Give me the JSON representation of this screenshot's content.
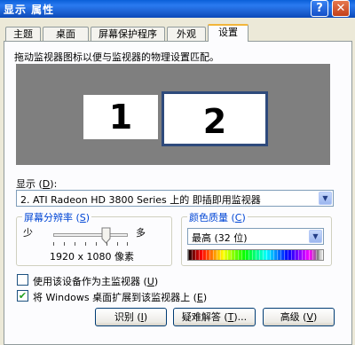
{
  "window": {
    "title": "显示 属性",
    "help_glyph": "?",
    "close_glyph": "✕"
  },
  "tabs": [
    {
      "label": "主题"
    },
    {
      "label": "桌面"
    },
    {
      "label": "屏幕保护程序"
    },
    {
      "label": "外观"
    },
    {
      "label": "设置",
      "active": true
    }
  ],
  "settings": {
    "instruction": "拖动监视器图标以便与监视器的物理设置匹配。",
    "monitors": [
      {
        "number": "1",
        "selected": false
      },
      {
        "number": "2",
        "selected": true
      }
    ],
    "display_label_prefix": "显示 (",
    "display_label_key": "D",
    "display_label_suffix": "):",
    "display_value": "2. ATI Radeon HD 3800 Series  上的 即插即用监视器",
    "resolution": {
      "title_prefix": "屏幕分辨率 (",
      "title_key": "S",
      "title_suffix": ")",
      "less": "少",
      "more": "多",
      "value": "1920 x 1080 像素",
      "slider_level": 0.65
    },
    "color_quality": {
      "title_prefix": "颜色质量 (",
      "title_key": "C",
      "title_suffix": ")",
      "value": "最高 (32 位)"
    },
    "checkbox_primary": {
      "label_prefix": "使用该设备作为主监视器 (",
      "label_key": "U",
      "label_suffix": ")",
      "checked": false
    },
    "checkbox_extend": {
      "label_prefix": "将 Windows 桌面扩展到该监视器上 (",
      "label_key": "E",
      "label_suffix": ")",
      "checked": true
    },
    "buttons": {
      "identify_prefix": "识别 (",
      "identify_key": "I",
      "identify_suffix": ")",
      "troubleshoot_prefix": "疑难解答 (",
      "troubleshoot_key": "T",
      "troubleshoot_suffix": ")...",
      "advanced_prefix": "高级 (",
      "advanced_key": "V",
      "advanced_suffix": ")"
    }
  },
  "colors": {
    "titlebar": "#1b5fd0",
    "tab_highlight": "#f2b63a",
    "groupbox_title": "#0046d5",
    "preview_background": "#7f7f7f",
    "checkmark": "#21a121"
  }
}
